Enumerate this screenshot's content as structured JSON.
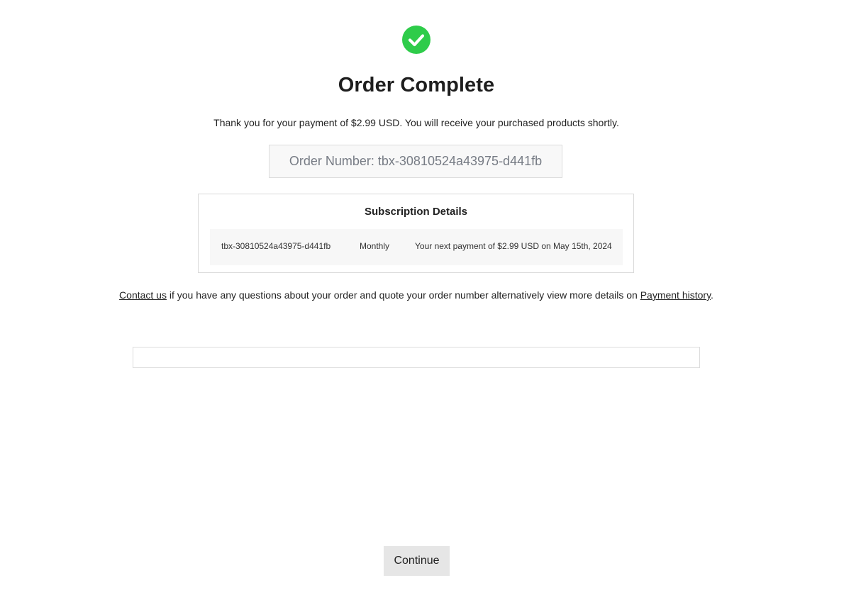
{
  "colors": {
    "success_green": "#2ecc4a",
    "button_bg": "#e6e6e6",
    "order_box_bg": "#f8f8f8"
  },
  "status_icon": "check-circle-icon",
  "title": "Order Complete",
  "thanks_message": "Thank you for your payment of $2.99 USD. You will receive your purchased products shortly.",
  "order_number": "Order Number: tbx-30810524a43975-d441fb",
  "subscription": {
    "title": "Subscription Details",
    "id": "tbx-30810524a43975-d441fb",
    "plan": "Monthly",
    "next_payment": "Your next payment of $2.99 USD on May 15th, 2024"
  },
  "contact": {
    "link_label": "Contact us",
    "middle_text": " if you have any questions about your order and quote your order number alternatively view more details on ",
    "history_label": "Payment history",
    "end_text": "."
  },
  "continue_label": "Continue"
}
